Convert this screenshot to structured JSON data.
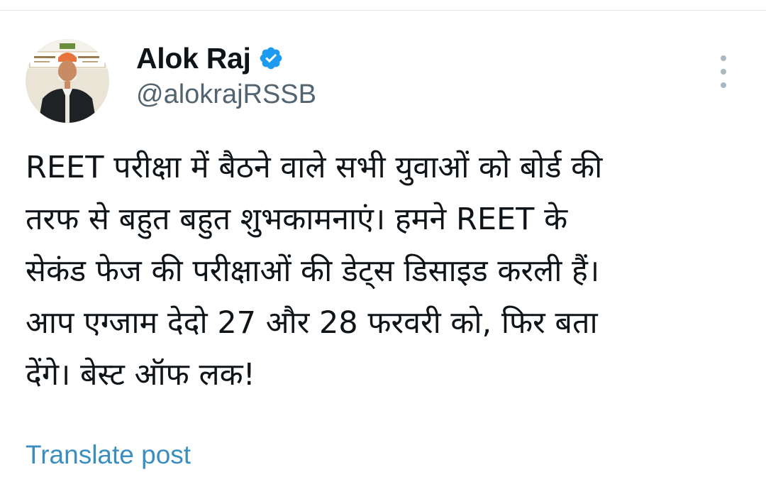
{
  "author": {
    "display_name": "Alok Raj",
    "handle": "@alokrajRSSB",
    "verified": true,
    "avatar_icon": "profile-photo"
  },
  "tweet": {
    "lines": [
      "REET परीक्षा में बैठने वाले सभी युवाओं को बोर्ड की",
      "तरफ से बहुत बहुत शुभकामनाएं। हमने REET के",
      "सेकंड फेज की परीक्षाओं की डेट्स डिसाइड करली हैं।",
      "आप एग्जाम देदो 27 और 28 फरवरी को, फिर बता",
      "देंगे। बेस्ट ऑफ लक!"
    ]
  },
  "actions": {
    "translate_label": "Translate post",
    "more_icon": "more-vertical-icon"
  },
  "colors": {
    "text": "#0f1419",
    "secondary": "#536471",
    "link": "#3b8fc0",
    "verified": "#1d9bf0"
  }
}
